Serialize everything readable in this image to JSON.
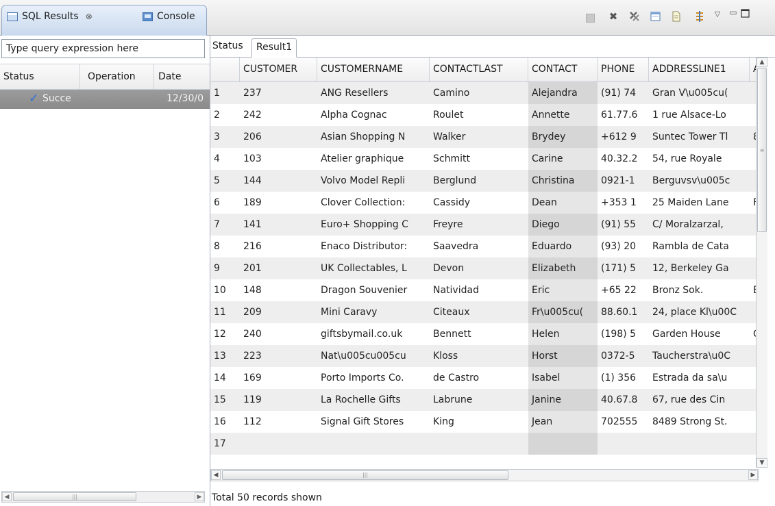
{
  "tabs": {
    "sql_results": "SQL Results",
    "sql_results_close": "⊗",
    "console": "Console"
  },
  "toolbar": {
    "icons": [
      "stop-icon",
      "remove-icon",
      "remove-all-icon",
      "open-icon",
      "save-icon",
      "pin-icon",
      "view-menu-icon",
      "minimize-icon",
      "maximize-icon"
    ]
  },
  "left": {
    "query_placeholder": "Type query expression here",
    "columns": [
      "Status",
      "Operation",
      "Date"
    ],
    "rows": [
      {
        "status": "Succe",
        "operation": "",
        "date": "12/30/0"
      }
    ]
  },
  "right": {
    "subtabs": [
      "Status",
      "Result1"
    ],
    "columns": [
      "",
      "CUSTOMER",
      "CUSTOMERNAME",
      "CONTACTLAST",
      "CONTACT",
      "PHONE",
      "ADDRESSLINE1",
      "A"
    ],
    "rows": [
      [
        "1",
        "237",
        "ANG Resellers",
        "Camino",
        "Alejandra",
        "(91) 74",
        "Gran V\\u005cu(",
        ""
      ],
      [
        "2",
        "242",
        "Alpha Cognac",
        "Roulet",
        "Annette",
        "61.77.6",
        "1 rue Alsace-Lo",
        ""
      ],
      [
        "3",
        "206",
        "Asian Shopping N",
        "Walker",
        "Brydey",
        "+612 9",
        "Suntec Tower Tl",
        "8"
      ],
      [
        "4",
        "103",
        "Atelier graphique",
        "Schmitt",
        "Carine",
        "40.32.2",
        "54, rue Royale",
        ""
      ],
      [
        "5",
        "144",
        "Volvo Model Repli",
        "Berglund",
        "Christina",
        "0921-1",
        "Berguvsv\\u005c",
        ""
      ],
      [
        "6",
        "189",
        "Clover Collection:",
        "Cassidy",
        "Dean",
        "+353 1",
        "25 Maiden Lane",
        "F"
      ],
      [
        "7",
        "141",
        "Euro+ Shopping C",
        "Freyre",
        "Diego",
        "(91) 55",
        "C/ Moralzarzal,",
        ""
      ],
      [
        "8",
        "216",
        "Enaco Distributor:",
        "Saavedra",
        "Eduardo",
        "(93) 20",
        "Rambla de Cata",
        ""
      ],
      [
        "9",
        "201",
        "UK Collectables, L",
        "Devon",
        "Elizabeth",
        "(171) 5",
        "12, Berkeley Ga",
        ""
      ],
      [
        "10",
        "148",
        "Dragon Souvenier",
        "Natividad",
        "Eric",
        "+65 22",
        "Bronz Sok.",
        "B"
      ],
      [
        "11",
        "209",
        "Mini Caravy",
        "Citeaux",
        "Fr\\u005cu(",
        "88.60.1",
        "24, place Kl\\u00C",
        ""
      ],
      [
        "12",
        "240",
        "giftsbymail.co.uk",
        "Bennett",
        "Helen",
        "(198) 5",
        "Garden House",
        "C"
      ],
      [
        "13",
        "223",
        "Nat\\u005cu005cu",
        "Kloss",
        "Horst",
        "0372-5",
        "Taucherstra\\u0C",
        ""
      ],
      [
        "14",
        "169",
        "Porto Imports Co.",
        "de Castro",
        "Isabel",
        "(1) 356",
        "Estrada da sa\\u",
        ""
      ],
      [
        "15",
        "119",
        "La Rochelle Gifts",
        "Labrune",
        "Janine",
        "40.67.8",
        "67, rue des Cin",
        ""
      ],
      [
        "16",
        "112",
        "Signal Gift Stores",
        "King",
        "Jean",
        "702555",
        "8489 Strong St.",
        ""
      ],
      [
        "17",
        "",
        "",
        "",
        "",
        "",
        "",
        ""
      ]
    ],
    "status_text": "Total 50 records shown"
  }
}
